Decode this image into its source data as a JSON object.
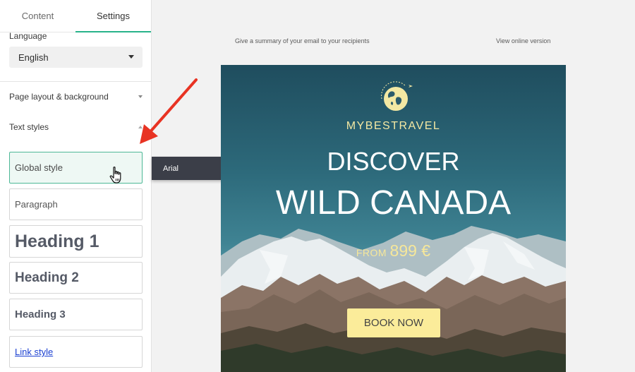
{
  "sidebar": {
    "tabs": [
      {
        "label": "Content",
        "active": false
      },
      {
        "label": "Settings",
        "active": true
      }
    ],
    "language": {
      "label": "Language",
      "value": "English"
    },
    "sections": {
      "layout": "Page layout & background",
      "text_styles": "Text styles"
    },
    "styles": {
      "global": "Global style",
      "paragraph": "Paragraph",
      "heading1": "Heading 1",
      "heading2": "Heading 2",
      "heading3": "Heading 3",
      "link": "Link style"
    }
  },
  "font_toolbar": {
    "font": "Arial",
    "format_icon": "font-settings-icon"
  },
  "email": {
    "preheader": "Give a summary of your email to your recipients",
    "view_online": "View online version",
    "hero": {
      "brand": "MYBESTRAVEL",
      "line1": "DISCOVER",
      "line2": "WILD CANADA",
      "from": "FROM",
      "price": "899 €",
      "cta": "BOOK NOW"
    }
  },
  "colors": {
    "accent": "#28b38a",
    "annotation_arrow": "#e83323",
    "brand_yellow": "#f3e8a3",
    "cta_bg": "#fbec9a",
    "toolbar_bg": "#3b3e48"
  }
}
